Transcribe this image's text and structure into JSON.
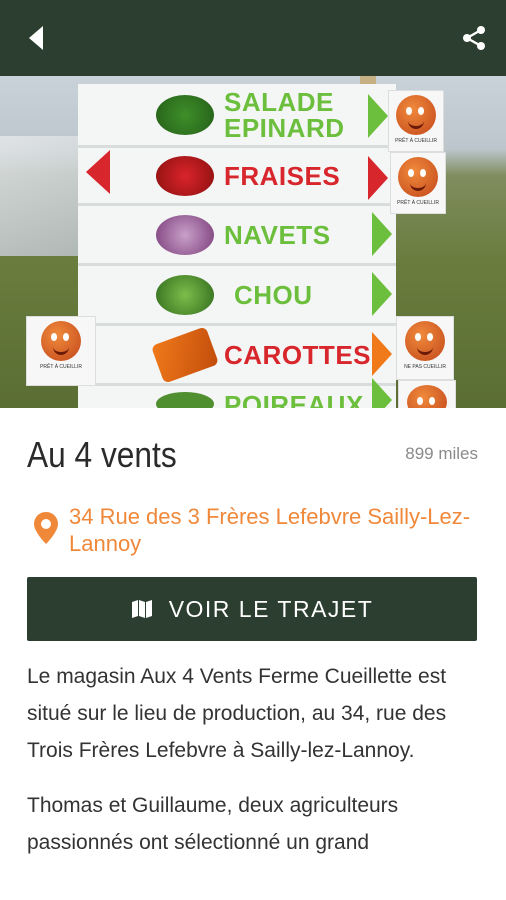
{
  "header": {
    "back_icon": "back-arrow-icon",
    "share_icon": "share-icon",
    "background": "#2c3e2f"
  },
  "hero": {
    "signs": [
      {
        "label": "SALADE\nEPINARD",
        "color": "#6cbf3c",
        "arrow": "right"
      },
      {
        "label": "FRAISES",
        "color": "#d7262c",
        "arrow": "both"
      },
      {
        "label": "NAVETS",
        "color": "#6cbf3c",
        "arrow": "right"
      },
      {
        "label": "CHOU",
        "color": "#6cbf3c",
        "arrow": "right"
      },
      {
        "label": "CAROTTES",
        "color": "#d7262c",
        "arrow": "right"
      },
      {
        "label": "POIREAUX",
        "color": "#6cbf3c",
        "arrow": "right"
      }
    ],
    "smiley_tag_ready": "PRÊT À CUEILLIR",
    "smiley_tag_notready": "NE PAS CUEILLIR"
  },
  "shop": {
    "name": "Au 4 vents",
    "distance": "899 miles",
    "address": "34 Rue des 3 Frères Lefebvre Sailly-Lez-Lannoy",
    "address_color": "#f0883a",
    "route_button": "VOIR LE TRAJET",
    "route_icon": "map-icon",
    "description": [
      "Le magasin Aux 4 Vents Ferme Cueillette est situé sur le lieu de production, au 34, rue des Trois Frères Lefebvre à Sailly-lez-Lannoy.",
      "Thomas et Guillaume, deux agriculteurs passionnés ont sélectionné un grand"
    ]
  }
}
